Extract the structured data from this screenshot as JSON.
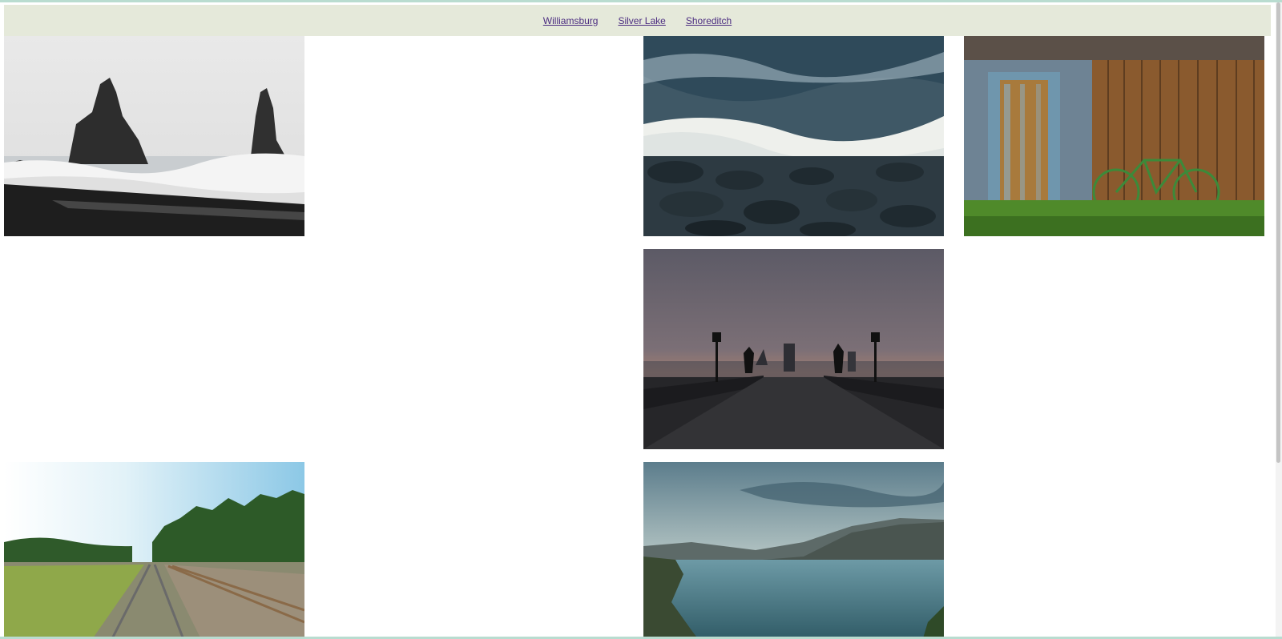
{
  "nav": {
    "links": [
      {
        "label": "Williamsburg"
      },
      {
        "label": "Silver Lake"
      },
      {
        "label": "Shoreditch"
      }
    ]
  },
  "gallery": {
    "photos": [
      {
        "subject": "sea-stacks"
      },
      {
        "subject": "ocean-waves"
      },
      {
        "subject": "wooden-shed-bicycle"
      },
      {
        "subject": "bridge-at-dusk"
      },
      {
        "subject": "railroad-tracks"
      },
      {
        "subject": "mountain-lake"
      }
    ]
  },
  "colors": {
    "navbar_background": "#e5e9da",
    "link": "#4b2c80",
    "accent": "#b9dcd0"
  }
}
